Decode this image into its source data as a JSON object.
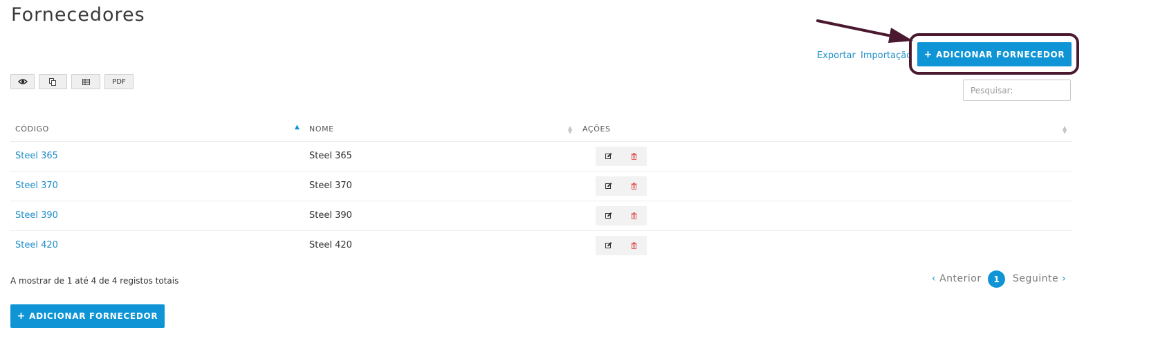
{
  "page": {
    "title": "Fornecedores"
  },
  "header_links": {
    "export": "Exportar",
    "import": "Importação"
  },
  "add_button_top": {
    "icon": "+",
    "label": "ADICIONAR FORNECEDOR"
  },
  "toolbar": {
    "view_icon": "eye-icon",
    "copy_icon": "copy-icon",
    "csv_icon": "table-icon",
    "pdf_label": "PDF"
  },
  "search": {
    "placeholder": "Pesquisar:"
  },
  "table": {
    "columns": [
      "CÓDIGO",
      "NOME",
      "AÇÕES"
    ],
    "rows": [
      {
        "code": "Steel 365",
        "name": "Steel 365"
      },
      {
        "code": "Steel 370",
        "name": "Steel 370"
      },
      {
        "code": "Steel 390",
        "name": "Steel 390"
      },
      {
        "code": "Steel 420",
        "name": "Steel 420"
      }
    ],
    "edit_icon": "edit-icon",
    "delete_icon": "trash-icon"
  },
  "footer": {
    "info": "A mostrar de 1 até 4 de 4 registos totais"
  },
  "pagination": {
    "prev": "Anterior",
    "current": "1",
    "next": "Seguinte"
  },
  "add_button_bottom": {
    "icon": "+",
    "label": "ADICIONAR FORNECEDOR"
  },
  "colors": {
    "accent": "#0f95d6",
    "link": "#1e8ec9",
    "annotation": "#4a1930",
    "delete": "#e05a5a"
  }
}
